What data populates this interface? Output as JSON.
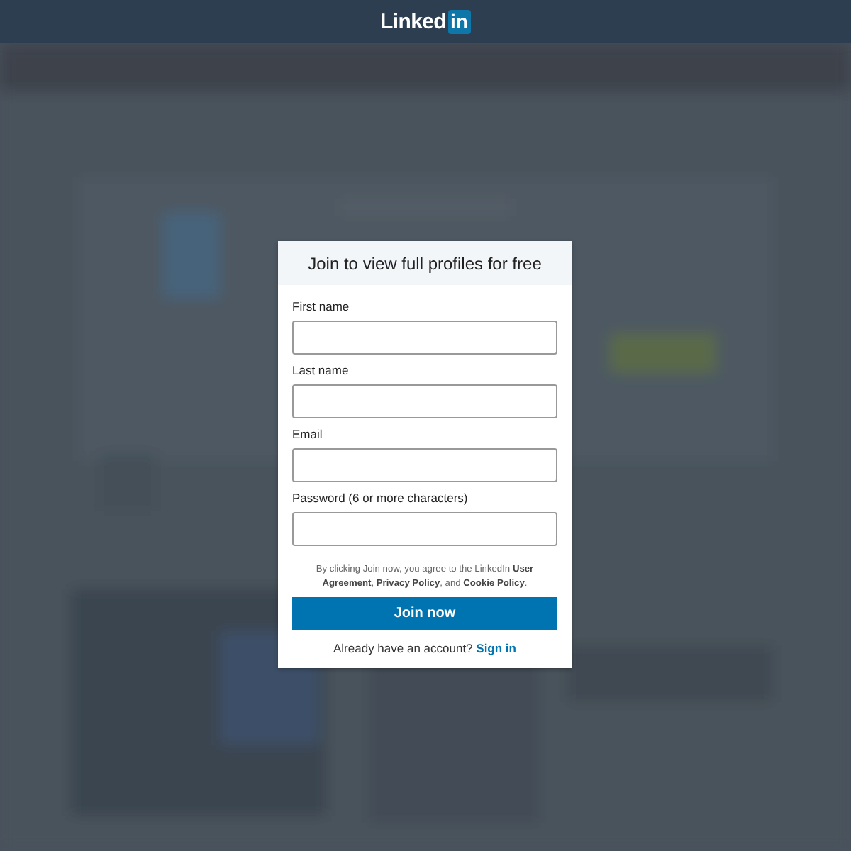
{
  "header": {
    "logo_text": "Linked",
    "logo_badge": "in"
  },
  "dialog": {
    "title": "Join to view full profiles for free",
    "fields": [
      {
        "label": "First name"
      },
      {
        "label": "Last name"
      },
      {
        "label": "Email"
      },
      {
        "label": "Password (6 or more characters)"
      }
    ],
    "terms": "By clicking Join now, you agree to the LinkedIn **User Agreement**, **Privacy Policy**, and **Cookie Policy**.",
    "submit": "Join now",
    "signin_prompt": "Already have an account?",
    "signin_link": "Sign in"
  }
}
